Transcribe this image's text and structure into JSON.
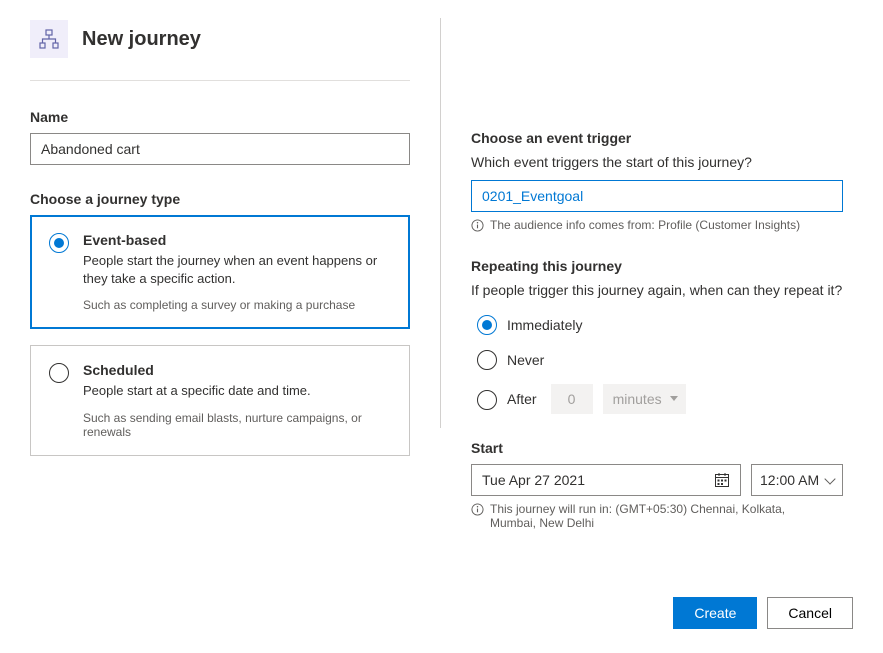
{
  "header": {
    "title": "New journey",
    "icon_name": "sitemap-icon"
  },
  "left": {
    "name_label": "Name",
    "name_value": "Abandoned cart",
    "journey_type_label": "Choose a journey type",
    "types": [
      {
        "title": "Event-based",
        "desc": "People start the journey when an event happens or they take a specific action.",
        "hint": "Such as completing a survey or making a purchase",
        "selected": true
      },
      {
        "title": "Scheduled",
        "desc": "People start at a specific date and time.",
        "hint": "Such as sending email blasts, nurture campaigns, or renewals",
        "selected": false
      }
    ]
  },
  "right": {
    "trigger_label": "Choose an event trigger",
    "trigger_sublabel": "Which event triggers the start of this journey?",
    "trigger_value": "0201_Eventgoal",
    "trigger_info": "The audience info comes from: Profile (Customer Insights)",
    "repeat_label": "Repeating this journey",
    "repeat_sublabel": "If people trigger this journey again, when can they repeat it?",
    "repeat_options": {
      "immediately": "Immediately",
      "never": "Never",
      "after": "After",
      "after_value": "0",
      "after_unit": "minutes"
    },
    "start_label": "Start",
    "start_date": "Tue Apr 27 2021",
    "start_time": "12:00 AM",
    "start_info": "This journey will run in: (GMT+05:30) Chennai, Kolkata, Mumbai, New Delhi"
  },
  "footer": {
    "create": "Create",
    "cancel": "Cancel"
  }
}
